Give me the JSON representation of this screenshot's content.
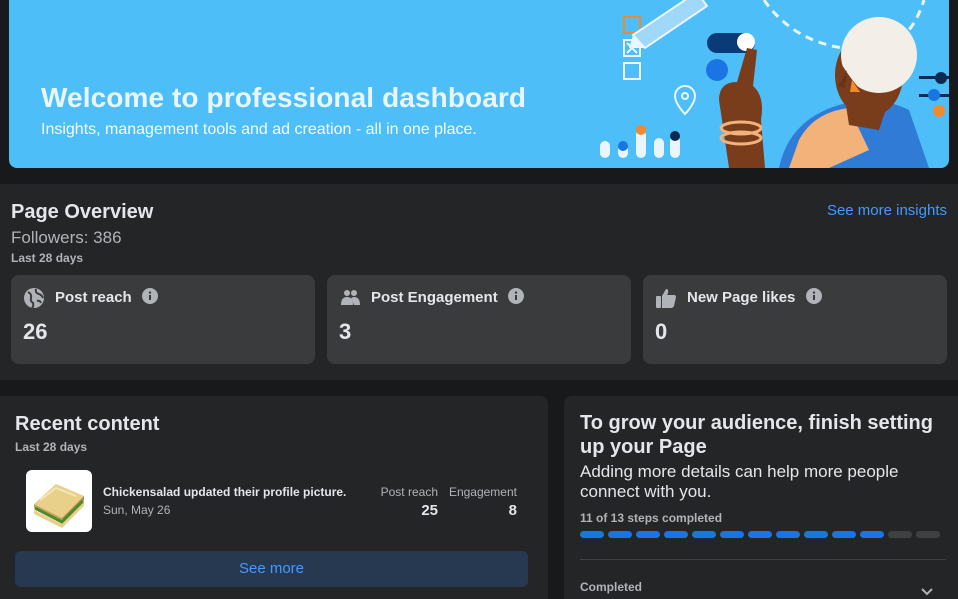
{
  "banner": {
    "title": "Welcome to professional dashboard",
    "subtitle": "Insights, management tools and ad creation - all in one place."
  },
  "overview": {
    "title": "Page Overview",
    "followers": "Followers: 386",
    "period": "Last 28 days",
    "see_more": "See more insights",
    "metrics": [
      {
        "label": "Post reach",
        "value": "26",
        "icon": "globe-icon"
      },
      {
        "label": "Post Engagement",
        "value": "3",
        "icon": "people-icon"
      },
      {
        "label": "New Page likes",
        "value": "0",
        "icon": "thumbs-up-icon"
      }
    ]
  },
  "recent": {
    "title": "Recent content",
    "period": "Last 28 days",
    "post": {
      "title": "Chickensalad updated their profile picture.",
      "date": "Sun, May 26",
      "reach_label": "Post reach",
      "reach_value": "25",
      "engagement_label": "Engagement",
      "engagement_value": "8"
    },
    "see_more": "See more"
  },
  "setup": {
    "title": "To grow your audience, finish setting up your Page",
    "description": "Adding more details can help more people connect with you.",
    "steps_text": "11 of 13 steps completed",
    "steps_done": 11,
    "steps_total": 13,
    "completed_label": "Completed"
  },
  "colors": {
    "accent": "#1b74e4",
    "link": "#4599ff",
    "banner": "#4dbef8",
    "card": "#242526",
    "tile": "#3a3b3c"
  }
}
